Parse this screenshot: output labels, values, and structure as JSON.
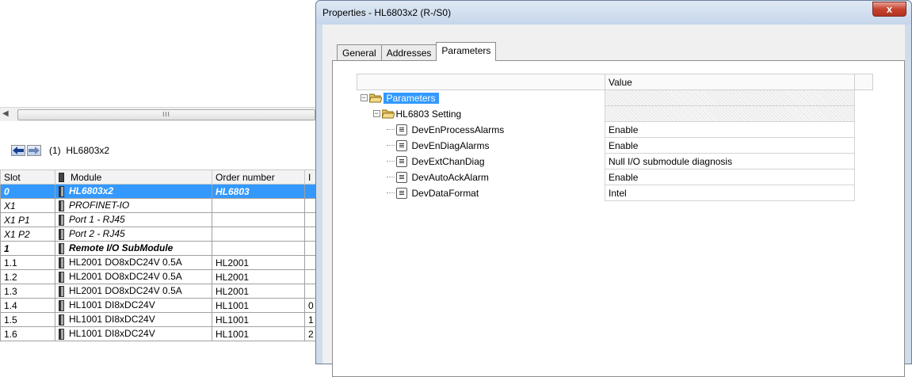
{
  "background_window": {
    "scroll_thumb_grip": "III",
    "station": {
      "number": "(1)",
      "name": "HL6803x2"
    },
    "grid": {
      "headers": [
        "Slot",
        "Module",
        "Order number",
        "I"
      ],
      "rows": [
        {
          "slot": "0",
          "module": "HL6803x2",
          "order": "HL6803",
          "i": "",
          "style": "sel"
        },
        {
          "slot": "X1",
          "module": "PROFINET-IO",
          "order": "",
          "i": "",
          "style": "it"
        },
        {
          "slot": "X1 P1",
          "module": "Port 1 - RJ45",
          "order": "",
          "i": "",
          "style": "it"
        },
        {
          "slot": "X1 P2",
          "module": "Port 2 - RJ45",
          "order": "",
          "i": "",
          "style": "it"
        },
        {
          "slot": "1",
          "module": "Remote I/O SubModule",
          "order": "",
          "i": "",
          "style": "bi"
        },
        {
          "slot": "1.1",
          "module": "HL2001 DO8xDC24V 0.5A",
          "order": "HL2001",
          "i": "",
          "style": ""
        },
        {
          "slot": "1.2",
          "module": "HL2001 DO8xDC24V 0.5A",
          "order": "HL2001",
          "i": "",
          "style": ""
        },
        {
          "slot": "1.3",
          "module": "HL2001 DO8xDC24V 0.5A",
          "order": "HL2001",
          "i": "",
          "style": ""
        },
        {
          "slot": "1.4",
          "module": "HL1001 DI8xDC24V",
          "order": "HL1001",
          "i": "0",
          "style": ""
        },
        {
          "slot": "1.5",
          "module": "HL1001 DI8xDC24V",
          "order": "HL1001",
          "i": "1",
          "style": ""
        },
        {
          "slot": "1.6",
          "module": "HL1001 DI8xDC24V",
          "order": "HL1001",
          "i": "2",
          "style": ""
        }
      ]
    }
  },
  "dialog": {
    "title": "Properties - HL6803x2  (R-/S0)",
    "close_label": "x",
    "tabs": [
      {
        "label": "General",
        "active": false
      },
      {
        "label": "Addresses",
        "active": false
      },
      {
        "label": "Parameters",
        "active": true
      }
    ],
    "tree": {
      "value_header": "Value",
      "root": "Parameters",
      "group": "HL6803 Setting",
      "params": [
        {
          "name": "DevEnProcessAlarms",
          "value": "Enable"
        },
        {
          "name": "DevEnDiagAlarms",
          "value": "Enable"
        },
        {
          "name": "DevExtChanDiag",
          "value": "Null I/O submodule diagnosis"
        },
        {
          "name": "DevAutoAckAlarm",
          "value": "Enable"
        },
        {
          "name": "DevDataFormat",
          "value": "Intel"
        }
      ]
    }
  },
  "colors": {
    "selection": "#3399ff",
    "close_button": "#c7432f",
    "frame": "#cfdcec"
  }
}
